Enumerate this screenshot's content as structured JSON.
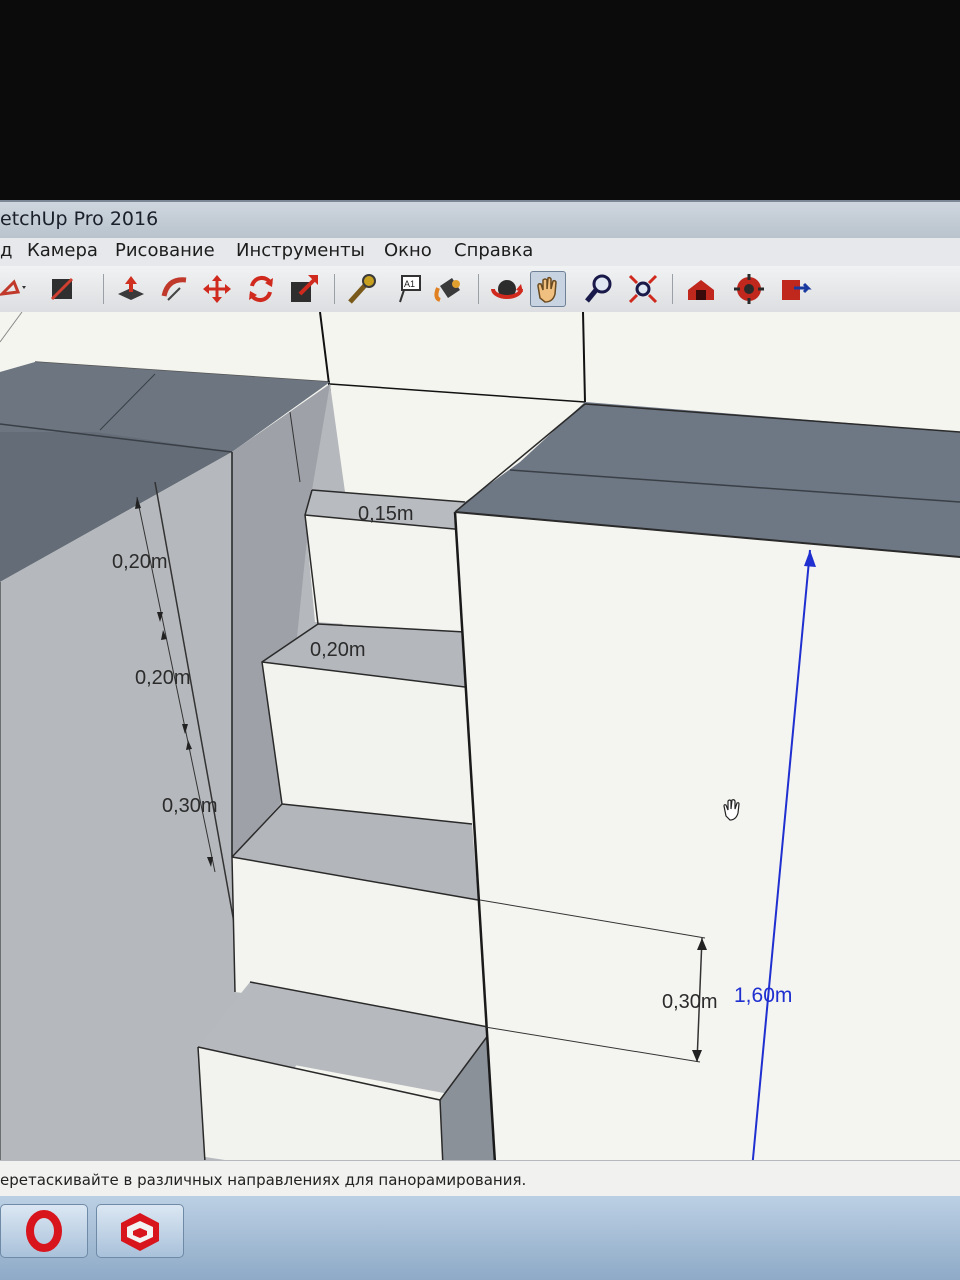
{
  "window": {
    "title": "etchUp Pro 2016"
  },
  "menu": {
    "items": [
      "д",
      "Камера",
      "Рисование",
      "Инструменты",
      "Окно",
      "Справка"
    ]
  },
  "toolbar": {
    "tools": [
      {
        "icon": "select-arrow-icon",
        "active": false
      },
      {
        "icon": "material-swatch-icon",
        "active": false
      },
      {
        "icon": "push-pull-icon",
        "active": false
      },
      {
        "icon": "follow-me-icon",
        "active": false
      },
      {
        "icon": "move-icon",
        "active": false
      },
      {
        "icon": "rotate-icon",
        "active": false
      },
      {
        "icon": "scale-icon",
        "active": false
      },
      {
        "icon": "tape-measure-icon",
        "active": false
      },
      {
        "icon": "text-label-icon",
        "active": false
      },
      {
        "icon": "paint-bucket-icon",
        "active": false
      },
      {
        "icon": "orbit-icon",
        "active": false
      },
      {
        "icon": "pan-hand-icon",
        "active": true
      },
      {
        "icon": "zoom-icon",
        "active": false
      },
      {
        "icon": "zoom-extents-icon",
        "active": false
      },
      {
        "icon": "warehouse-icon",
        "active": false
      },
      {
        "icon": "extension-warehouse-icon",
        "active": false
      },
      {
        "icon": "share-model-icon",
        "active": false
      }
    ]
  },
  "dimensions": {
    "tread_top": "0,15m",
    "tread_second": "0,20m",
    "riser_left_1": "0,20m",
    "riser_left_2": "0,20m",
    "riser_left_3": "0,30m",
    "riser_right": "0,30m",
    "total_height": "1,60m"
  },
  "statusbar": {
    "hint": "еретаскивайте в различных направлениях для панорамирования."
  },
  "colors": {
    "accent_dimension": "#1f2fd0",
    "face_dark": "#6e7784",
    "face_light": "#f2f2ee"
  }
}
